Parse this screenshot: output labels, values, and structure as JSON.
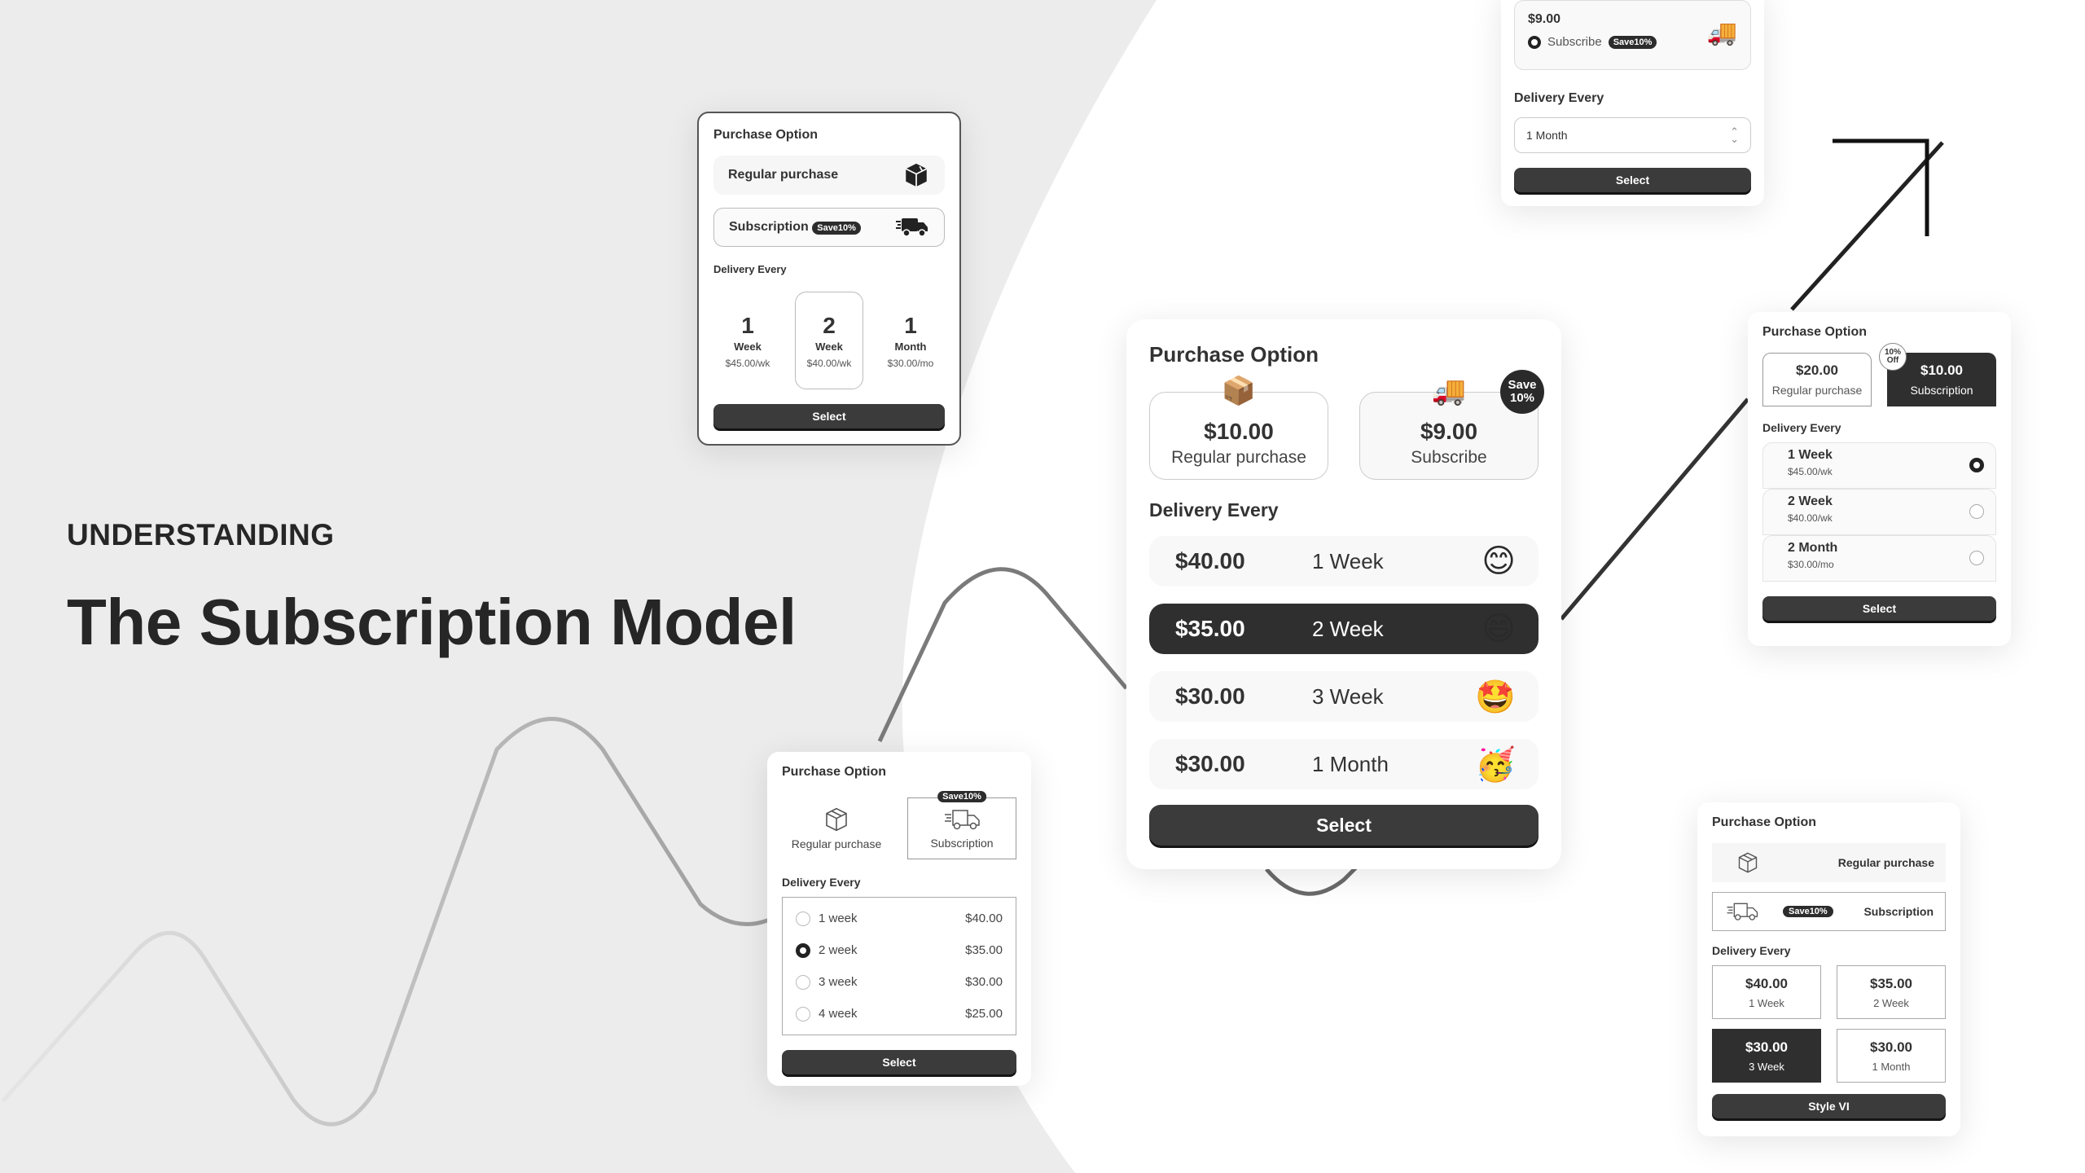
{
  "hero": {
    "eyebrow": "UNDERSTANDING",
    "headline": "The Subscription Model"
  },
  "colors": {
    "background": "#ececec",
    "card": "#ffffff",
    "dark": "#2f2f2f",
    "button": "#3b3b3b",
    "line_gray": "#a8a8a8",
    "arrow": "#111111"
  },
  "cards": {
    "style_a": {
      "title": "Purchase Option",
      "options": [
        {
          "label": "Regular purchase",
          "icon": "package-icon"
        },
        {
          "label": "Subscription",
          "badge": "Save10%",
          "icon": "delivery-truck-icon"
        }
      ],
      "delivery_label": "Delivery Every",
      "frequencies": [
        {
          "num": "1",
          "unit": "Week",
          "price": "$45.00/wk"
        },
        {
          "num": "2",
          "unit": "Week",
          "price": "$40.00/wk",
          "selected": true
        },
        {
          "num": "1",
          "unit": "Month",
          "price": "$30.00/mo"
        }
      ],
      "button": "Select"
    },
    "style_b": {
      "title": "Purchase Option",
      "options": [
        {
          "price": "$10.00",
          "label": "Regular purchase",
          "emoji": "📦"
        },
        {
          "price": "$9.00",
          "label": "Subscribe",
          "emoji": "🚚",
          "badge_line1": "Save",
          "badge_line2": "10%"
        }
      ],
      "delivery_label": "Delivery Every",
      "rows": [
        {
          "price": "$40.00",
          "freq": "1 Week",
          "emoji": "😊"
        },
        {
          "price": "$35.00",
          "freq": "2 Week",
          "emoji": "😄",
          "selected": true
        },
        {
          "price": "$30.00",
          "freq": "3 Week",
          "emoji": "🤩"
        },
        {
          "price": "$30.00",
          "freq": "1 Month",
          "emoji": "🥳"
        }
      ],
      "button": "Select"
    },
    "style_c": {
      "option": {
        "price": "$9.00",
        "label": "Subscribe",
        "badge": "Save10%",
        "emoji": "🚚"
      },
      "delivery_label": "Delivery Every",
      "dropdown_value": "1 Month",
      "button": "Select"
    },
    "style_d": {
      "title": "Purchase Option",
      "options": [
        {
          "price": "$20.00",
          "label": "Regular purchase"
        },
        {
          "price": "$10.00",
          "label": "Subscription",
          "badge_line1": "10%",
          "badge_line2": "Off",
          "selected": true
        }
      ],
      "delivery_label": "Delivery Every",
      "rows": [
        {
          "freq": "1 Week",
          "price": "$45.00/wk",
          "selected": true
        },
        {
          "freq": "2 Week",
          "price": "$40.00/wk"
        },
        {
          "freq": "2 Month",
          "price": "$30.00/mo"
        }
      ],
      "button": "Select"
    },
    "style_e": {
      "title": "Purchase Option",
      "options": [
        {
          "label": "Regular purchase",
          "icon": "package-icon"
        },
        {
          "label": "Subscription",
          "badge": "Save10%",
          "icon": "delivery-truck-icon",
          "selected": true
        }
      ],
      "delivery_label": "Delivery Every",
      "items": [
        {
          "label": "1 week",
          "price": "$40.00"
        },
        {
          "label": "2 week",
          "price": "$35.00",
          "selected": true
        },
        {
          "label": "3 week",
          "price": "$30.00"
        },
        {
          "label": "4 week",
          "price": "$25.00"
        }
      ],
      "button": "Select"
    },
    "style_f": {
      "title": "Purchase Option",
      "options": [
        {
          "label": "Regular purchase",
          "icon": "package-icon"
        },
        {
          "label": "Subscription",
          "badge": "Save10%",
          "icon": "delivery-truck-icon",
          "selected": true
        }
      ],
      "delivery_label": "Delivery Every",
      "cells": [
        {
          "price": "$40.00",
          "label": "1 Week"
        },
        {
          "price": "$35.00",
          "label": "2 Week"
        },
        {
          "price": "$30.00",
          "label": "3 Week",
          "selected": true
        },
        {
          "price": "$30.00",
          "label": "1 Month"
        }
      ],
      "button": "Style VI"
    }
  },
  "icons": {
    "package_solid": "📦",
    "box_outline": "⬡",
    "truck_outline": "⛟",
    "chevron_updown": "⌃⌄"
  }
}
